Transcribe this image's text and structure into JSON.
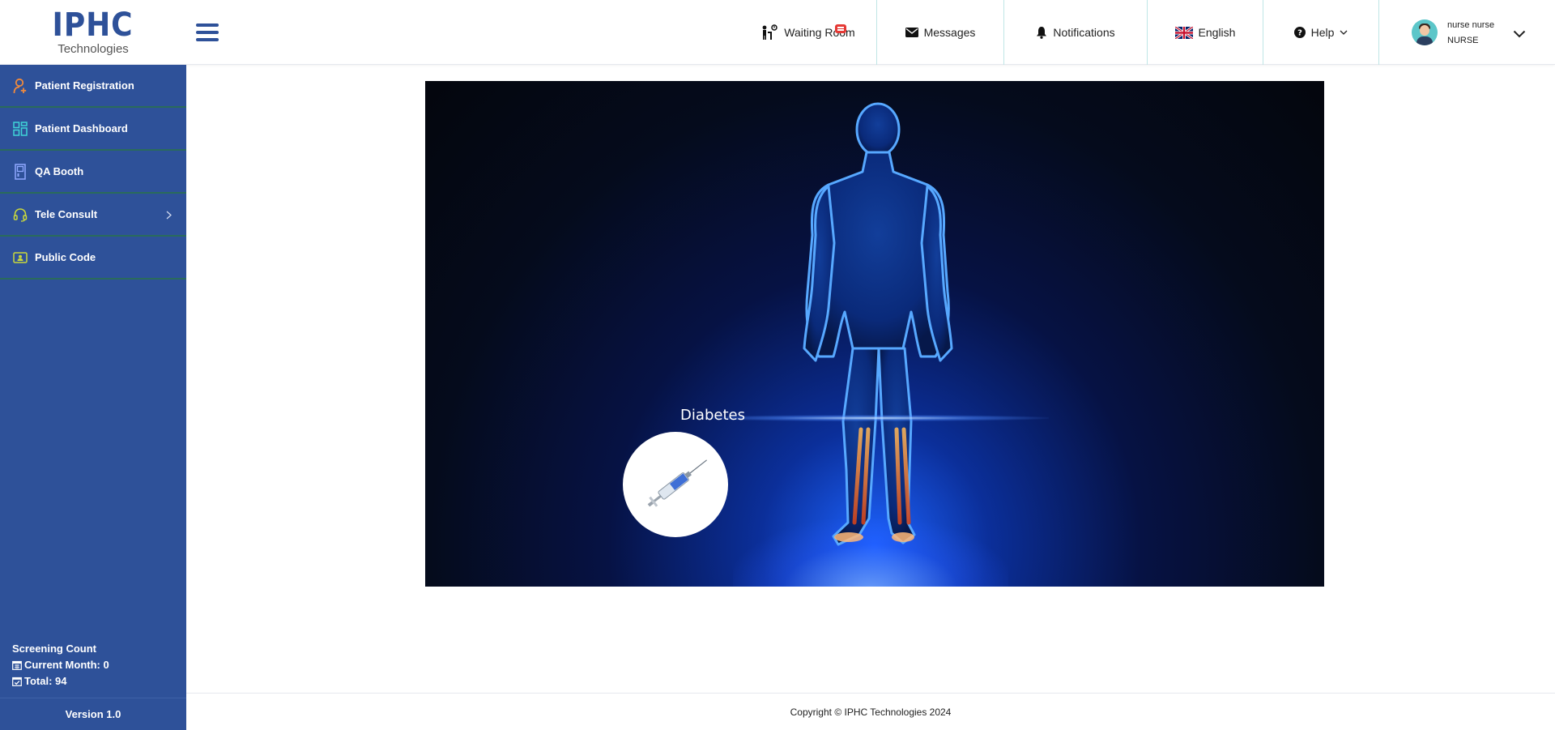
{
  "brand": {
    "name": "IPHC",
    "sub": "Technologies"
  },
  "header": {
    "nav": {
      "waiting_room": "Waiting Room",
      "messages": "Messages",
      "notifications": "Notifications",
      "language": "English",
      "help": "Help"
    },
    "user": {
      "name": "nurse nurse",
      "role": "NURSE"
    }
  },
  "sidebar": {
    "items": [
      {
        "label": "Patient Registration",
        "icon": "user-add-icon"
      },
      {
        "label": "Patient Dashboard",
        "icon": "dashboard-grid-icon"
      },
      {
        "label": "QA Booth",
        "icon": "booth-icon"
      },
      {
        "label": "Tele Consult",
        "icon": "headset-icon"
      },
      {
        "label": "Public Code",
        "icon": "id-card-icon"
      }
    ],
    "screening": {
      "title": "Screening Count",
      "current_month": "Current Month: 0",
      "total": "Total: 94"
    },
    "version": "Version 1.0"
  },
  "main": {
    "hero": {
      "label": "Diabetes"
    }
  },
  "footer": {
    "copyright": "Copyright © IPHC Technologies 2024"
  },
  "colors": {
    "primary": "#2e5199",
    "sidebar_divider": "#2a6b5b",
    "badge": "#e53935",
    "nav_divider": "#bfe6e6"
  }
}
